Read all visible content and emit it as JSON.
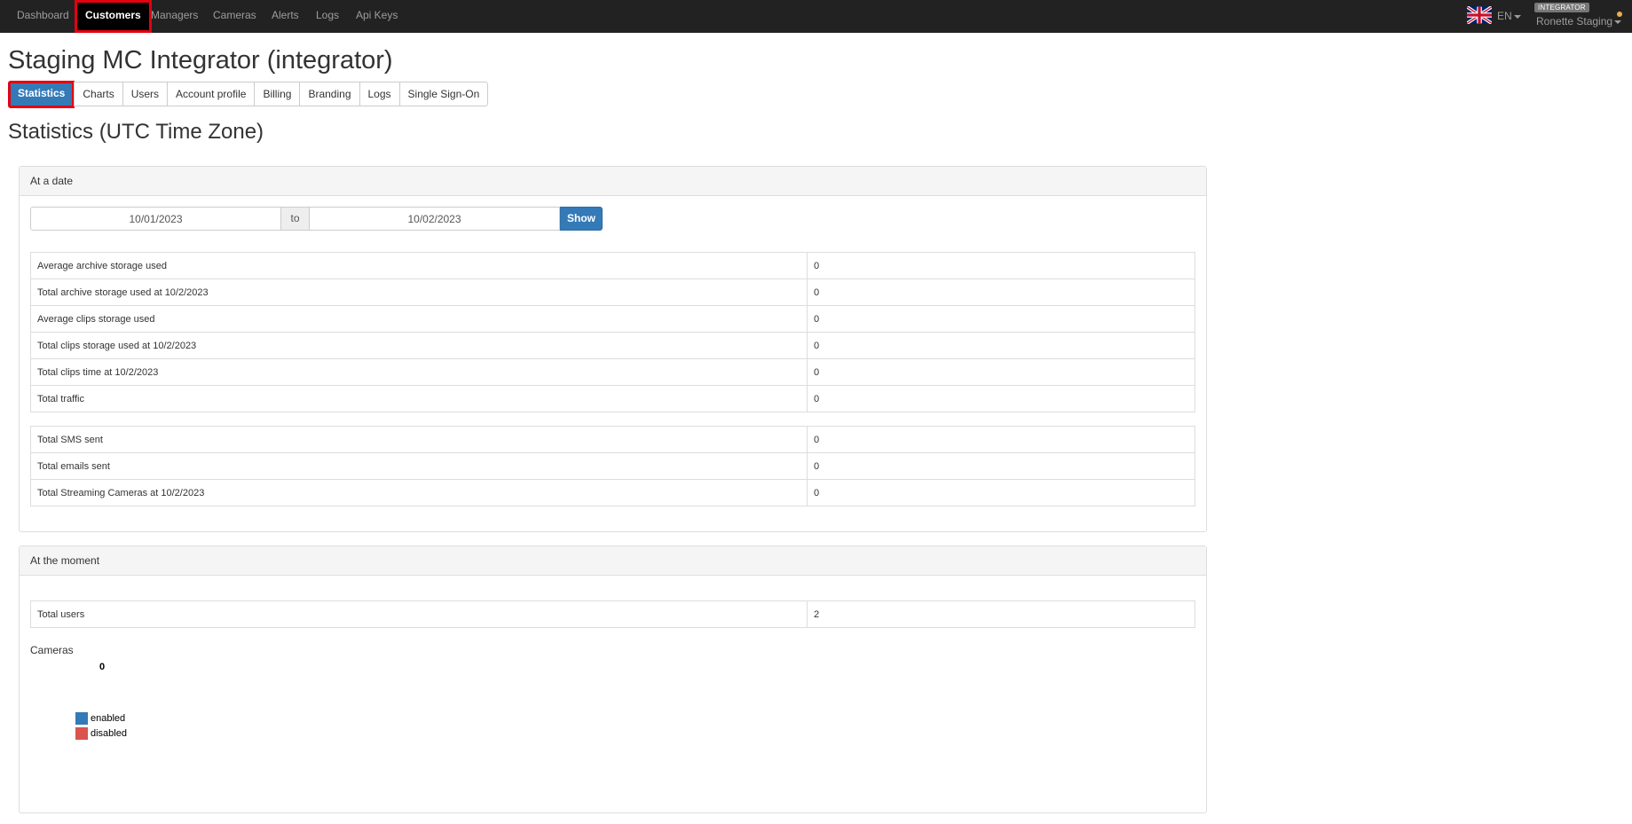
{
  "navbar": {
    "items": [
      {
        "label": "Dashboard"
      },
      {
        "label": "Customers"
      },
      {
        "label": "Managers"
      },
      {
        "label": "Cameras"
      },
      {
        "label": "Alerts"
      },
      {
        "label": "Logs"
      },
      {
        "label": "Api Keys"
      }
    ],
    "active": "Customers",
    "language": "EN",
    "role_badge": "INTEGRATOR",
    "user_name": "Ronette Staging",
    "status_color": "#f0ad4e"
  },
  "page": {
    "title": "Staging MC Integrator (integrator)",
    "tabs": [
      {
        "label": "Statistics"
      },
      {
        "label": "Charts"
      },
      {
        "label": "Users"
      },
      {
        "label": "Account profile"
      },
      {
        "label": "Billing"
      },
      {
        "label": "Branding"
      },
      {
        "label": "Logs"
      },
      {
        "label": "Single Sign-On"
      }
    ],
    "active_tab": "Statistics",
    "section_title": "Statistics (UTC Time Zone)"
  },
  "at_date_panel": {
    "heading": "At a date",
    "from_date": "10/01/2023",
    "separator": "to",
    "to_date": "10/02/2023",
    "show_label": "Show",
    "storage_rows": [
      {
        "label": "Average archive storage used",
        "value": "0"
      },
      {
        "label": "Total archive storage used at 10/2/2023",
        "value": "0"
      },
      {
        "label": "Average clips storage used",
        "value": "0"
      },
      {
        "label": "Total clips storage used at 10/2/2023",
        "value": "0"
      },
      {
        "label": "Total clips time at 10/2/2023",
        "value": "0"
      },
      {
        "label": "Total traffic",
        "value": "0"
      }
    ],
    "messaging_rows": [
      {
        "label": "Total SMS sent",
        "value": "0"
      },
      {
        "label": "Total emails sent",
        "value": "0"
      },
      {
        "label": "Total Streaming Cameras at 10/2/2023",
        "value": "0"
      }
    ]
  },
  "at_moment_panel": {
    "heading": "At the moment",
    "rows": [
      {
        "label": "Total users",
        "value": "2"
      }
    ],
    "cameras_label": "Cameras",
    "pie_value": "0",
    "legend": [
      {
        "label": "enabled",
        "color": "#337ab7"
      },
      {
        "label": "disabled",
        "color": "#d9534f"
      }
    ]
  },
  "colors": {
    "navbar_bg": "#222222",
    "primary": "#337ab7",
    "highlight": "#e3000f"
  }
}
